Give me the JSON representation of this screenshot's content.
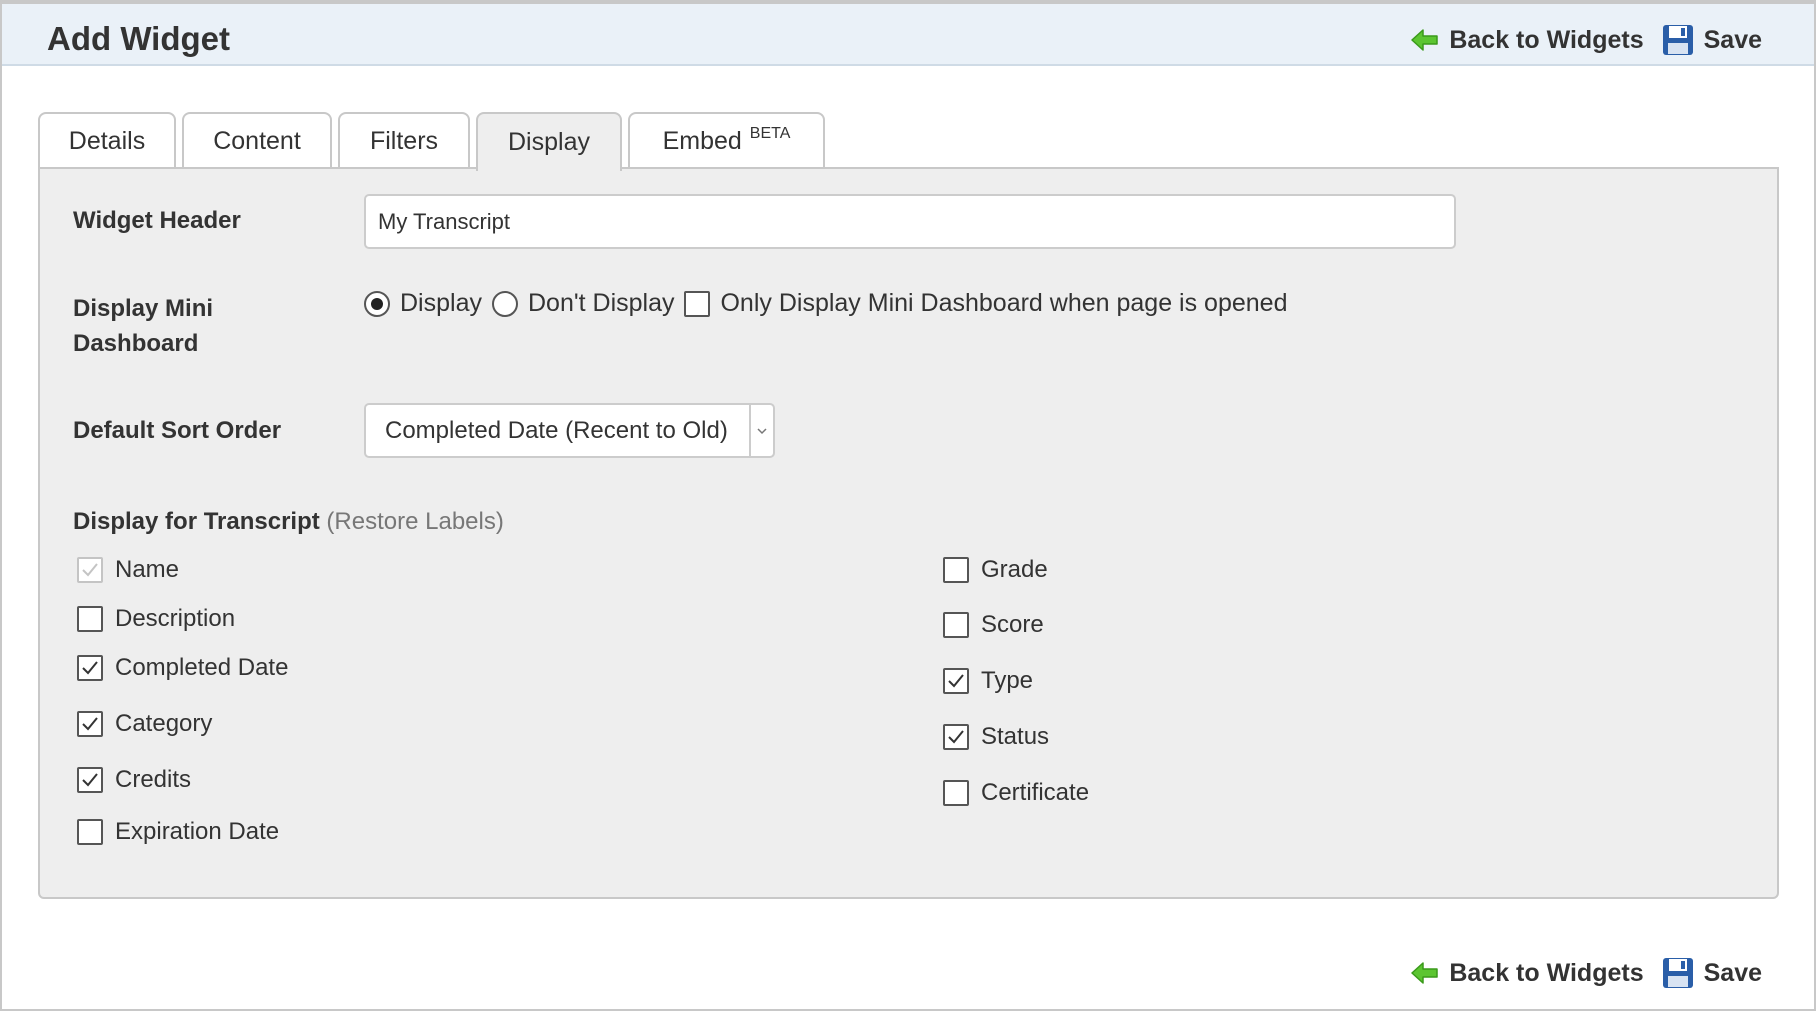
{
  "header": {
    "title": "Add Widget"
  },
  "actions": {
    "back_label": "Back to Widgets",
    "save_label": "Save"
  },
  "tabs": [
    {
      "label": "Details",
      "active": false
    },
    {
      "label": "Content",
      "active": false
    },
    {
      "label": "Filters",
      "active": false
    },
    {
      "label": "Display",
      "active": true
    },
    {
      "label": "Embed",
      "badge": "BETA",
      "active": false
    }
  ],
  "form": {
    "widget_header": {
      "label": "Widget Header",
      "value": "My Transcript"
    },
    "mini_dashboard": {
      "label_line1": "Display Mini",
      "label_line2": "Dashboard",
      "options": [
        "Display",
        "Don't Display"
      ],
      "selected": "Display",
      "only_when_opened_label": "Only Display Mini Dashboard when page is opened",
      "only_when_opened_checked": false
    },
    "sort_order": {
      "label": "Default Sort Order",
      "value": "Completed Date (Recent to Old)"
    },
    "transcript": {
      "label": "Display for Transcript",
      "restore_label": "Restore Labels",
      "left_columns": [
        {
          "label": "Name",
          "checked": true,
          "disabled": true
        },
        {
          "label": "Description",
          "checked": false
        },
        {
          "label": "Completed Date",
          "checked": true
        },
        {
          "label": "Category",
          "checked": true
        },
        {
          "label": "Credits",
          "checked": true
        },
        {
          "label": "Expiration Date",
          "checked": false
        }
      ],
      "right_columns": [
        {
          "label": "Grade",
          "checked": false
        },
        {
          "label": "Score",
          "checked": false
        },
        {
          "label": "Type",
          "checked": true
        },
        {
          "label": "Status",
          "checked": true
        },
        {
          "label": "Certificate",
          "checked": false
        }
      ]
    }
  },
  "colors": {
    "header_bg": "#eaf1f8",
    "panel_bg": "#eeeeee",
    "arrow_green": "#5cc531",
    "save_blue": "#2a5ea8"
  },
  "icons": {
    "back": "green-left-arrow-icon",
    "save": "floppy-disk-icon"
  }
}
